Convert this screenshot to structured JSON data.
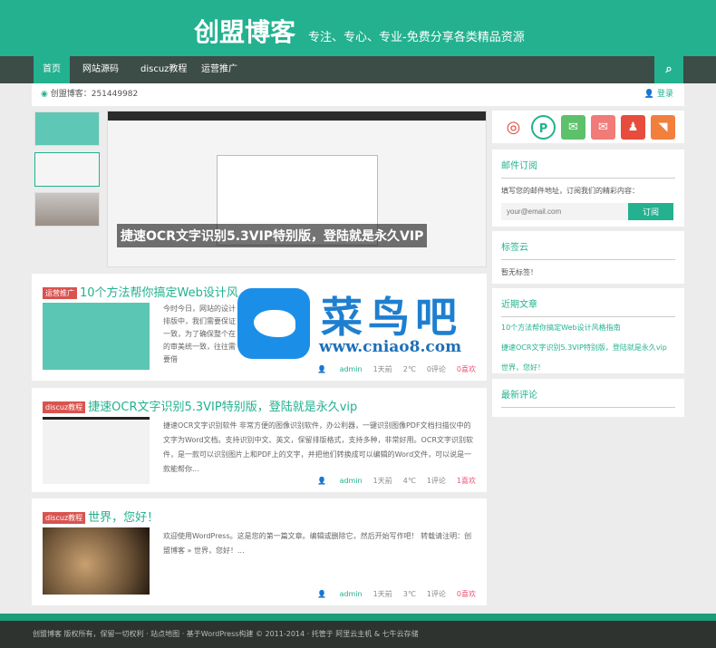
{
  "header": {
    "brand": "创盟博客",
    "slogan": "专注、专心、专业-免费分享各类精品资源"
  },
  "nav": {
    "items": [
      "首页",
      "网站源码",
      "discuz教程",
      "运营推广"
    ],
    "search_icon": "search-icon"
  },
  "topbar": {
    "left": "创盟博客：251449982",
    "right": "登录"
  },
  "slider": {
    "caption": "捷速OCR文字识别5.3VIP特别版，登陆就是永久VIP"
  },
  "posts": [
    {
      "tag": "运营推广",
      "title": "10个方法帮你搞定Web设计风",
      "excerpt": "今时今日，网站的设计排版中，我们需要保证一致，为了确保整个在的审美统一致，往往需要借",
      "author": "admin",
      "time": "1天前",
      "views": "2℃",
      "comments": "0评论",
      "likes": "0喜欢"
    },
    {
      "tag": "discuz教程",
      "title": "捷速OCR文字识别5.3VIP特别版，登陆就是永久vip",
      "excerpt": "捷速OCR文字识别软件 非常方便的图像识别软件，办公利器，一键识别图像PDF文档扫描仪中的文字为Word文档。支持识别中文、英文，保留排版格式，支持多种，非常好用。OCR文字识别软件，是一款可以识别图片上和PDF上的文字，并把他们转换成可以编辑的Word文件，可以说是一款能帮你...",
      "author": "admin",
      "time": "1天前",
      "views": "4℃",
      "comments": "1评论",
      "likes": "1喜欢"
    },
    {
      "tag": "discuz教程",
      "title": "世界，您好！",
      "excerpt": "欢迎使用WordPress。这是您的第一篇文章。编辑或删除它，然后开始写作吧！ 转载请注明：创盟博客 » 世界，您好！...",
      "author": "admin",
      "time": "1天前",
      "views": "3℃",
      "comments": "1评论",
      "likes": "0喜欢"
    }
  ],
  "sidebar": {
    "subscribe": {
      "title": "邮件订阅",
      "desc": "填写您的邮件地址，订阅我们的精彩内容：",
      "placeholder": "your@email.com",
      "button": "订阅"
    },
    "tags": {
      "title": "标签云",
      "empty": "暂无标签！"
    },
    "recent": {
      "title": "近期文章",
      "items": [
        "10个方法帮你搞定Web设计风格指南",
        "捷速OCR文字识别5.3VIP特别版，登陆就是永久vip",
        "世界，您好！"
      ]
    },
    "comments": {
      "title": "最新评论"
    }
  },
  "footer": {
    "text": "创盟博客 版权所有，保留一切权利 · 站点地图 · 基于WordPress构建 © 2011-2014 · 托管于 阿里云主机 & 七牛云存储"
  },
  "watermark": {
    "name": "菜鸟吧",
    "url": "www.cniao8.com"
  },
  "colors": {
    "accent": "#23b18f",
    "nav": "#3c4c47",
    "tag": "#d9534f"
  }
}
